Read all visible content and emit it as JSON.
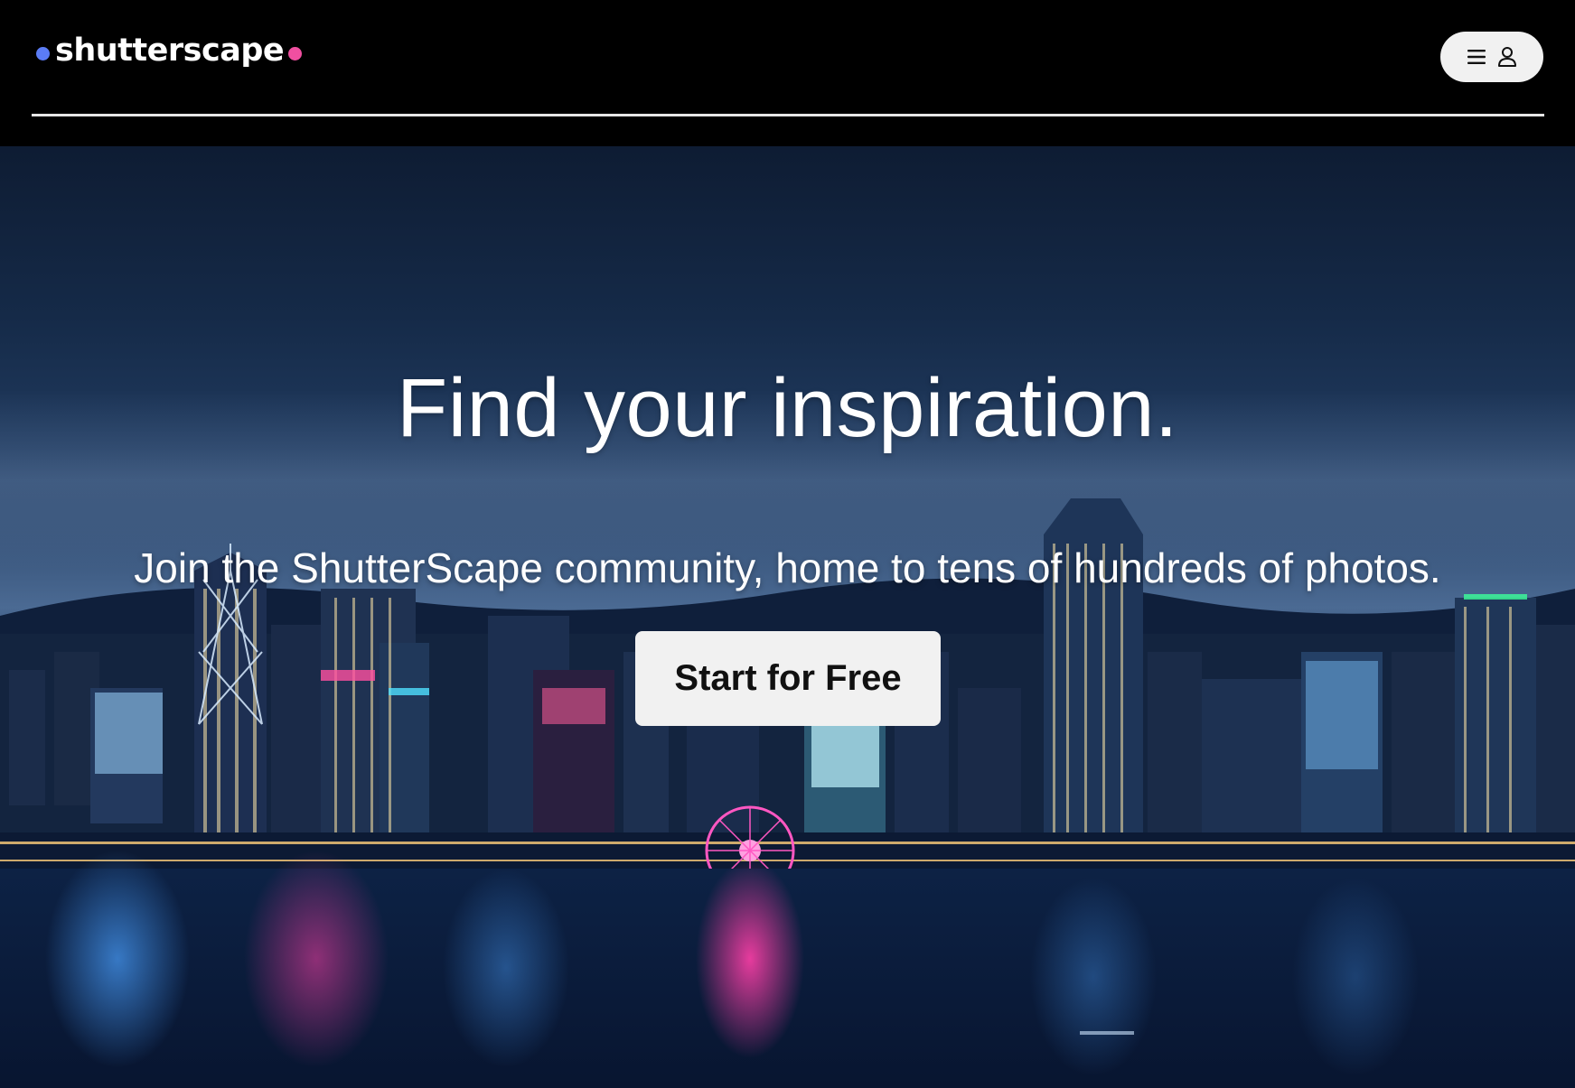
{
  "brand": {
    "name": "shutterscape",
    "dot_left_color": "#5b7cf5",
    "dot_right_color": "#f04fa0"
  },
  "header": {
    "menu_icon": "hamburger-menu-icon",
    "user_icon": "user-icon"
  },
  "hero": {
    "title": "Find your inspiration.",
    "subtitle": "Join the ShutterScape community, home to tens of hundreds of photos.",
    "cta_label": "Start for Free",
    "background_image": "night-city-skyline-harbor"
  }
}
